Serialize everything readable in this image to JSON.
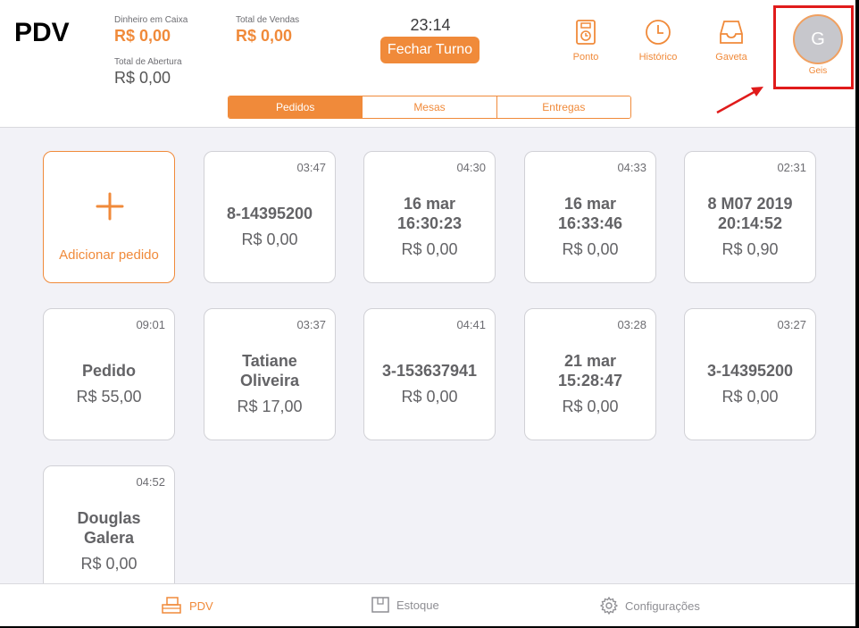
{
  "header": {
    "app_title": "PDV",
    "cash_label": "Dinheiro em Caixa",
    "cash_value": "R$ 0,00",
    "sales_label": "Total de Vendas",
    "sales_value": "R$ 0,00",
    "opening_label": "Total de Abertura",
    "opening_value": "R$ 0,00",
    "clock": "23:14",
    "close_shift_label": "Fechar Turno",
    "tools": [
      {
        "label": "Ponto",
        "icon": "time-clock-icon"
      },
      {
        "label": "Histórico",
        "icon": "clock-icon"
      },
      {
        "label": "Gaveta",
        "icon": "drawer-icon"
      }
    ],
    "profile": {
      "initial": "G",
      "name": "Geis"
    }
  },
  "segments": [
    {
      "label": "Pedidos",
      "active": true
    },
    {
      "label": "Mesas",
      "active": false
    },
    {
      "label": "Entregas",
      "active": false
    }
  ],
  "add_order_label": "Adicionar pedido",
  "orders": [
    {
      "time": "03:47",
      "title": [
        "8-14395200"
      ],
      "value": "R$ 0,00"
    },
    {
      "time": "04:30",
      "title": [
        "16 mar",
        "16:30:23"
      ],
      "value": "R$ 0,00"
    },
    {
      "time": "04:33",
      "title": [
        "16 mar",
        "16:33:46"
      ],
      "value": "R$ 0,00"
    },
    {
      "time": "02:31",
      "title": [
        "8 M07 2019",
        "20:14:52"
      ],
      "value": "R$ 0,90"
    },
    {
      "time": "09:01",
      "title": [
        "Pedido"
      ],
      "value": "R$ 55,00"
    },
    {
      "time": "03:37",
      "title": [
        "Tatiane",
        "Oliveira"
      ],
      "value": "R$ 17,00"
    },
    {
      "time": "04:41",
      "title": [
        "3-153637941"
      ],
      "value": "R$ 0,00"
    },
    {
      "time": "03:28",
      "title": [
        "21 mar",
        "15:28:47"
      ],
      "value": "R$ 0,00"
    },
    {
      "time": "03:27",
      "title": [
        "3-14395200"
      ],
      "value": "R$ 0,00"
    },
    {
      "time": "04:52",
      "title": [
        "Douglas",
        "Galera"
      ],
      "value": "R$ 0,00"
    }
  ],
  "tabbar": [
    {
      "label": "PDV",
      "icon": "register-icon",
      "active": true
    },
    {
      "label": "Estoque",
      "icon": "stock-icon",
      "active": false
    },
    {
      "label": "Configurações",
      "icon": "gear-icon",
      "active": false
    }
  ],
  "colors": {
    "accent": "#f08a3a",
    "highlight": "#e01b1b"
  }
}
